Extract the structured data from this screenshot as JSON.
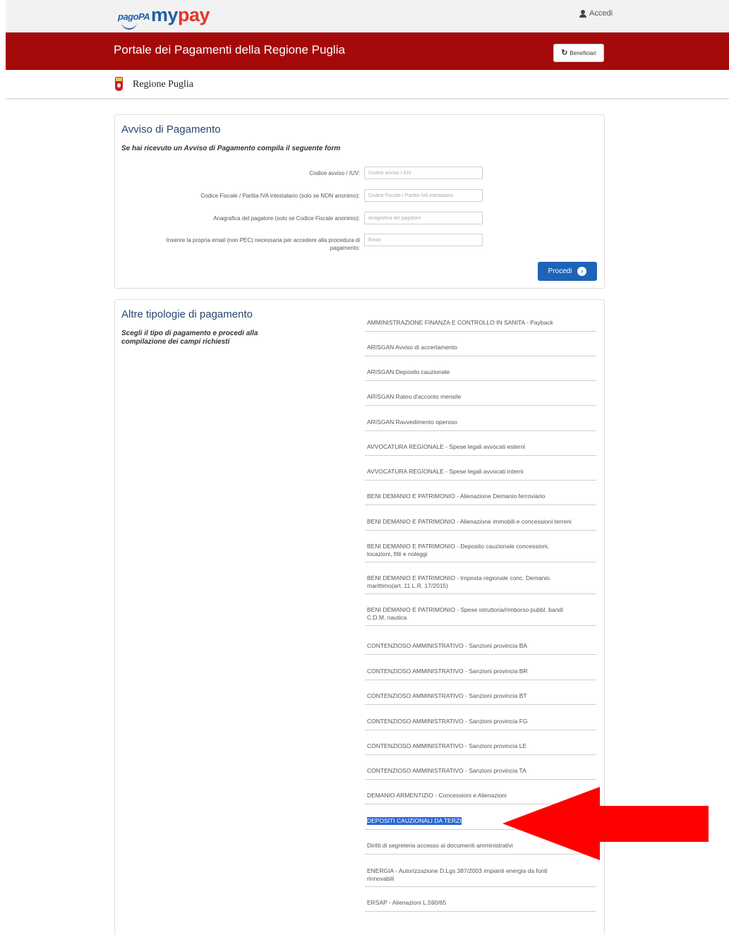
{
  "header": {
    "logo_pagopa": "pagoPA",
    "logo_my": "my",
    "logo_pay": "pay",
    "login_label": "Accedi"
  },
  "portal": {
    "title": "Portale dei Pagamenti della Regione Puglia",
    "beneficiari_label": "Beneficiari"
  },
  "region": {
    "name": "Regione Puglia"
  },
  "avviso": {
    "title": "Avviso di Pagamento",
    "subtitle": "Se hai ricevuto un Avviso di Pagamento compila il seguente form",
    "fields": [
      {
        "label": "Codice avviso / IUV:",
        "placeholder": "Codice avviso / IUV"
      },
      {
        "label": "Codice Fiscale / Partita IVA intestatario (solo se NON anonimo):",
        "placeholder": "Codice Fiscale / Partita IVA intestatario"
      },
      {
        "label": "Anagrafica del pagatore (solo se Codice Fiscale anonimo):",
        "placeholder": "Anagrafica del pagatore"
      },
      {
        "label_line1": "Inserire la propria email (non PEC) necessaria per accedere alla procedura di",
        "label_line2": "pagamento:",
        "placeholder": "Email"
      }
    ],
    "submit_label": "Procedi"
  },
  "altre": {
    "title": "Altre tipologie di pagamento",
    "subtitle_line1": "Scegli il tipo di pagamento e procedi alla",
    "subtitle_line2": "compilazione dei campi richiesti",
    "items": [
      {
        "text": "AMMINISTRAZIONE FINANZA E CONTROLLO IN SANITA - Payback",
        "selected": false
      },
      {
        "text": "ARISGAN Avviso di accertamento",
        "selected": false
      },
      {
        "text": "ARISGAN Deposito cauzionale",
        "selected": false
      },
      {
        "text": "ARISGAN Rateo d'acconto mensile",
        "selected": false
      },
      {
        "text": "ARISGAN Ravvedimento operoso",
        "selected": false
      },
      {
        "text": "AVVOCATURA REGIONALE - Spese legali avvocati esterni",
        "selected": false
      },
      {
        "text": "AVVOCATURA REGIONALE - Spese legali avvocati interni",
        "selected": false
      },
      {
        "text": "BENI DEMANIO E PATRIMONIO - Alienazione Demanio ferroviario",
        "selected": false
      },
      {
        "text": "BENI DEMANIO E PATRIMONIO - Alienazione immobili e concessioni terreni",
        "selected": false
      },
      {
        "text": "BENI DEMANIO E PATRIMONIO - Deposito cauzionale concessioni,",
        "text2": "locazioni, fitti e noleggi",
        "selected": false
      },
      {
        "text": "BENI DEMANIO E PATRIMONIO - Imposta regionale conc. Demanio",
        "text2": "marittimo(art. 11 L.R. 17/2015)",
        "selected": false
      },
      {
        "text": "BENI DEMANIO E PATRIMONIO - Spese istruttoria/rimborso pubbl. bandi",
        "text2": "C.D.M. nautica",
        "selected": false
      },
      {
        "text": "CONTENZIOSO AMMINISTRATIVO - Sanzioni provincia BA",
        "selected": false
      },
      {
        "text": "CONTENZIOSO AMMINISTRATIVO - Sanzioni provincia BR",
        "selected": false
      },
      {
        "text": "CONTENZIOSO AMMINISTRATIVO - Sanzioni provincia BT",
        "selected": false
      },
      {
        "text": "CONTENZIOSO AMMINISTRATIVO - Sanzioni provincia FG",
        "selected": false
      },
      {
        "text": "CONTENZIOSO AMMINISTRATIVO - Sanzioni provincia LE",
        "selected": false
      },
      {
        "text": "CONTENZIOSO AMMINISTRATIVO - Sanzioni provincia TA",
        "selected": false
      },
      {
        "text": "DEMANIO ARMENTIZIO - Concessioni e Alienazioni",
        "selected": false
      },
      {
        "text": "DEPOSITI CAUZIONALI DA TERZI",
        "selected": true
      },
      {
        "text": "Diritti di segreteria accesso ai documenti amministrativi",
        "selected": false
      },
      {
        "text": "ENERGIA - Autorizzazione D.Lgs 387/2003 impianti energia da fonti",
        "text2": "rinnovabili",
        "selected": false
      },
      {
        "text": "ERSAP - Alienazioni L.590/65",
        "selected": false
      }
    ]
  },
  "colors": {
    "brand_red": "#a40a0a",
    "primary_blue": "#1e63b6",
    "selection_blue": "#2a66d3",
    "annotation_arrow": "#ff0000"
  }
}
